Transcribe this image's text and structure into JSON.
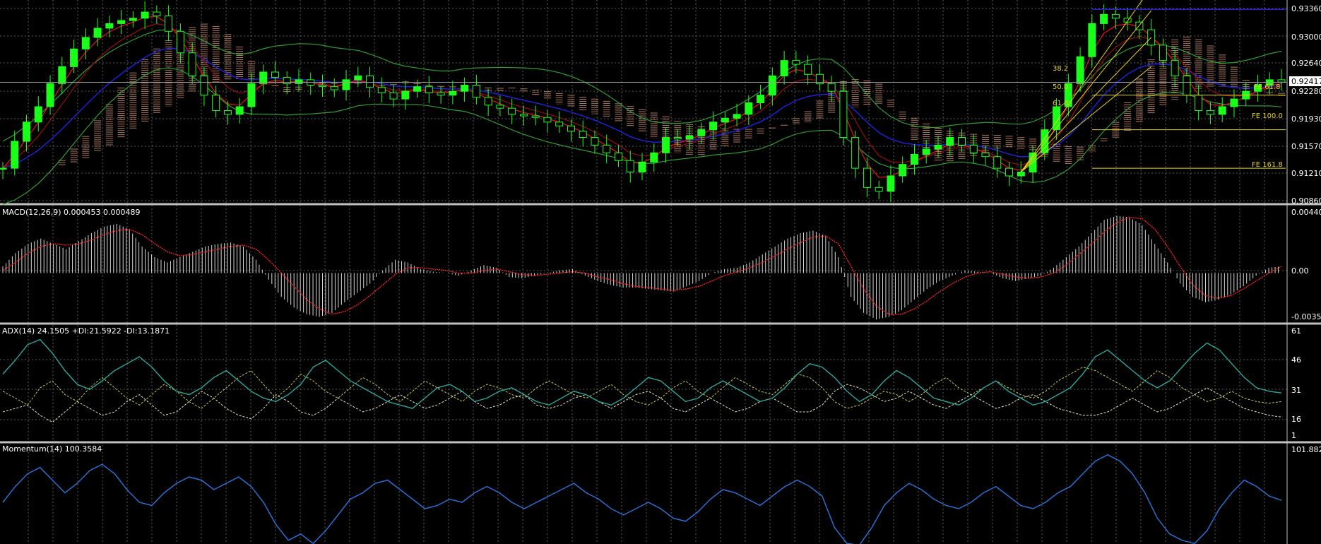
{
  "colors": {
    "background": "#000000",
    "grid": "#5a5a5a",
    "separator": "#bfbfbf",
    "candle": "#1aff1a",
    "bollinger": "#2e9e2e",
    "ma_blue": "#1f1fd6",
    "ma_red": "#e01010",
    "ma_darkred": "#8a0e0e",
    "cloud": "#e6a27a",
    "fib": "#e6d21a",
    "macd_hist": "#d8d8d8",
    "macd_signal": "#ff2020",
    "adx_main": "#2aa79b",
    "plus_di": "#c8c84a",
    "minus_di": "#e6e6c8",
    "momentum": "#2a6fd1",
    "price_box_bg": "#ffffff",
    "text": "#ffffff"
  },
  "price_panel": {
    "axis_labels": [
      "0.93360",
      "0.93000",
      "0.92640",
      "0.92280",
      "0.91930",
      "0.91570",
      "0.91210",
      "0.90860"
    ],
    "current_price": "0.92417",
    "fib_retracement_labels": [
      "38.2",
      "50.0",
      "61.8"
    ],
    "fib_expansion_labels": [
      "FE 61.8",
      "FE 100.0",
      "FE 161.8"
    ]
  },
  "macd_panel": {
    "title": "MACD(12,26,9) 0.000453 0.000489",
    "axis_labels": [
      "0.004405",
      "0.00",
      "-0.003527"
    ]
  },
  "adx_panel": {
    "title": "ADX(14) 24.1505 +DI:21.5922 -DI:13.1871",
    "axis_labels": [
      "61",
      "46",
      "31",
      "16",
      "1"
    ]
  },
  "momentum_panel": {
    "title": "Momentum(14) 100.3584",
    "axis_labels": [
      "101.8825"
    ]
  },
  "chart_data": [
    {
      "type": "line",
      "subtype": "candlestick",
      "ylim": [
        0.9086,
        0.9345
      ],
      "y_ticks": [
        0.9336,
        0.93,
        0.9264,
        0.9228,
        0.9193,
        0.9157,
        0.9121,
        0.9086
      ],
      "grid": true,
      "series": [
        {
          "values": [
            0.913,
            0.9165,
            0.919,
            0.921,
            0.924,
            0.9262,
            0.9285,
            0.93,
            0.9312,
            0.9318,
            0.9322,
            0.9325,
            0.9333,
            0.9328,
            0.9308,
            0.928,
            0.925,
            0.9225,
            0.9205,
            0.92,
            0.921,
            0.924,
            0.9255,
            0.9248,
            0.924,
            0.9245,
            0.9238,
            0.9236,
            0.9232,
            0.9245,
            0.925,
            0.9235,
            0.9228,
            0.922,
            0.923,
            0.9236,
            0.9228,
            0.9225,
            0.923,
            0.9238,
            0.9222,
            0.9212,
            0.9208,
            0.92,
            0.9198,
            0.9196,
            0.919,
            0.9185,
            0.9178,
            0.917,
            0.916,
            0.915,
            0.914,
            0.9125,
            0.9138,
            0.915,
            0.917,
            0.9168,
            0.9172,
            0.918,
            0.919,
            0.9195,
            0.92,
            0.9215,
            0.9225,
            0.925,
            0.927,
            0.9265,
            0.9252,
            0.924,
            0.923,
            0.917,
            0.913,
            0.9105,
            0.91,
            0.912,
            0.9135,
            0.9148,
            0.9155,
            0.916,
            0.917,
            0.916,
            0.915,
            0.9145,
            0.913,
            0.912,
            0.9125,
            0.915,
            0.918,
            0.921,
            0.924,
            0.9275,
            0.9318,
            0.933,
            0.9325,
            0.932,
            0.931,
            0.929,
            0.927,
            0.925,
            0.9225,
            0.9205,
            0.92,
            0.921,
            0.922,
            0.923,
            0.9238,
            0.9245,
            0.9242
          ]
        }
      ]
    },
    {
      "type": "bar",
      "title": "MACD(12,26,9) 0.000453 0.000489",
      "ylim": [
        -0.0037,
        0.0046
      ],
      "y_ticks": [
        0.004405,
        0.0,
        -0.003527
      ],
      "series": [
        {
          "values": [
            0.0005,
            0.0015,
            0.0022,
            0.0026,
            0.0022,
            0.0018,
            0.0024,
            0.003,
            0.0035,
            0.0037,
            0.0033,
            0.002,
            0.0012,
            0.0008,
            0.0012,
            0.0016,
            0.002,
            0.0022,
            0.0023,
            0.002,
            0.001,
            -0.0005,
            -0.0018,
            -0.0026,
            -0.0031,
            -0.0033,
            -0.003,
            -0.0022,
            -0.0015,
            -0.0008,
            0.0002,
            0.001,
            0.0008,
            0.0003,
            0.0001,
            0.0,
            -0.0002,
            0.0002,
            0.0006,
            0.0004,
            -0.0003,
            -0.0004,
            -0.0002,
            0.0,
            0.0002,
            0.0003,
            -0.0002,
            -0.0006,
            -0.0009,
            -0.0011,
            -0.0011,
            -0.0012,
            -0.0013,
            -0.0014,
            -0.001,
            -0.0006,
            0.0,
            0.0003,
            0.0004,
            0.0008,
            0.0014,
            0.002,
            0.0026,
            0.003,
            0.0032,
            0.0028,
            0.0012,
            -0.0018,
            -0.003,
            -0.0035,
            -0.0033,
            -0.0028,
            -0.002,
            -0.0012,
            -0.0006,
            -0.0002,
            0.0002,
            0.0001,
            0.0,
            -0.0004,
            -0.0006,
            -0.0004,
            -0.0002,
            0.0004,
            0.0012,
            0.002,
            0.003,
            0.004,
            0.0043,
            0.0042,
            0.0036,
            0.0022,
            0.0008,
            -0.0008,
            -0.0018,
            -0.0022,
            -0.002,
            -0.0016,
            -0.001,
            -0.0002,
            0.0004,
            0.0005
          ]
        },
        {
          "values": [
            0.0002,
            0.0008,
            0.0015,
            0.002,
            0.0022,
            0.0021,
            0.0022,
            0.0025,
            0.0029,
            0.0032,
            0.0033,
            0.0029,
            0.0022,
            0.0016,
            0.0013,
            0.0014,
            0.0016,
            0.0018,
            0.002,
            0.0021,
            0.0018,
            0.001,
            0.0,
            -0.001,
            -0.002,
            -0.0027,
            -0.0031,
            -0.0029,
            -0.0024,
            -0.0017,
            -0.0009,
            -0.0001,
            0.0004,
            0.0004,
            0.0003,
            0.0002,
            0.0,
            0.0,
            0.0002,
            0.0003,
            0.0001,
            -0.0001,
            -0.0002,
            -0.0001,
            0.0,
            0.0001,
            0.0,
            -0.0003,
            -0.0005,
            -0.0008,
            -0.001,
            -0.0011,
            -0.0012,
            -0.0013,
            -0.0012,
            -0.001,
            -0.0006,
            -0.0002,
            0.0001,
            0.0004,
            0.0008,
            0.0013,
            0.0018,
            0.0023,
            0.0027,
            0.0028,
            0.0022,
            0.0005,
            -0.0012,
            -0.0025,
            -0.0031,
            -0.0031,
            -0.0027,
            -0.0021,
            -0.0014,
            -0.0008,
            -0.0003,
            0.0,
            0.0001,
            -0.0001,
            -0.0003,
            -0.0004,
            -0.0003,
            0.0,
            0.0006,
            0.0014,
            0.0022,
            0.0031,
            0.0038,
            0.0042,
            0.0041,
            0.0033,
            0.002,
            0.0005,
            -0.0009,
            -0.0017,
            -0.0019,
            -0.0017,
            -0.0012,
            -0.0006,
            0.0,
            0.0005
          ]
        }
      ]
    },
    {
      "type": "line",
      "title": "ADX(14) 24.1505 +DI:21.5922 -DI:13.1871",
      "ylim": [
        0,
        64
      ],
      "y_ticks": [
        61,
        46,
        31,
        16,
        1
      ],
      "series": [
        {
          "values": [
            38,
            46,
            55,
            58,
            50,
            40,
            32,
            29,
            34,
            40,
            44,
            48,
            42,
            34,
            28,
            26,
            30,
            36,
            40,
            34,
            28,
            24,
            22,
            26,
            32,
            42,
            46,
            40,
            34,
            30,
            26,
            22,
            20,
            18,
            24,
            30,
            32,
            28,
            22,
            24,
            28,
            30,
            26,
            22,
            20,
            24,
            28,
            26,
            22,
            20,
            24,
            30,
            36,
            34,
            28,
            22,
            24,
            30,
            34,
            30,
            26,
            22,
            24,
            30,
            38,
            44,
            42,
            36,
            28,
            22,
            26,
            34,
            40,
            36,
            30,
            24,
            22,
            20,
            24,
            30,
            34,
            28,
            24,
            20,
            22,
            26,
            30,
            38,
            48,
            52,
            46,
            40,
            34,
            30,
            34,
            42,
            50,
            56,
            52,
            44,
            36,
            30,
            28,
            27
          ]
        },
        {
          "values": [
            28,
            24,
            20,
            30,
            34,
            26,
            22,
            30,
            36,
            30,
            24,
            20,
            26,
            32,
            28,
            22,
            18,
            24,
            30,
            36,
            40,
            32,
            24,
            30,
            38,
            34,
            28,
            24,
            30,
            36,
            32,
            26,
            22,
            28,
            34,
            30,
            26,
            22,
            28,
            32,
            30,
            26,
            24,
            30,
            34,
            30,
            26,
            24,
            28,
            32,
            26,
            22,
            20,
            24,
            30,
            34,
            28,
            24,
            30,
            36,
            32,
            28,
            26,
            32,
            38,
            36,
            30,
            22,
            18,
            20,
            24,
            28,
            26,
            22,
            26,
            32,
            36,
            30,
            26,
            30,
            34,
            30,
            26,
            24,
            28,
            34,
            38,
            42,
            40,
            36,
            32,
            28,
            34,
            40,
            36,
            30,
            26,
            22,
            24,
            28,
            24,
            22,
            21,
            22
          ]
        },
        {
          "values": [
            16,
            18,
            20,
            14,
            10,
            16,
            22,
            18,
            14,
            16,
            22,
            26,
            20,
            14,
            16,
            22,
            28,
            24,
            18,
            14,
            12,
            18,
            26,
            22,
            16,
            14,
            18,
            24,
            20,
            16,
            18,
            22,
            26,
            22,
            18,
            20,
            24,
            28,
            22,
            18,
            20,
            24,
            26,
            20,
            18,
            20,
            24,
            26,
            22,
            18,
            22,
            26,
            28,
            24,
            18,
            16,
            20,
            24,
            20,
            16,
            18,
            22,
            24,
            20,
            16,
            16,
            20,
            28,
            32,
            30,
            26,
            22,
            24,
            28,
            24,
            20,
            18,
            22,
            26,
            22,
            18,
            20,
            24,
            26,
            22,
            18,
            16,
            14,
            14,
            16,
            20,
            24,
            20,
            16,
            18,
            22,
            26,
            30,
            26,
            22,
            18,
            16,
            14,
            13
          ]
        }
      ]
    },
    {
      "type": "line",
      "title": "Momentum(14) 100.3584",
      "ylim": [
        98.85,
        101.95
      ],
      "y_ticks": [
        101.8825
      ],
      "series": [
        {
          "values": [
            100.3,
            100.8,
            101.2,
            101.4,
            101.0,
            100.6,
            100.9,
            101.3,
            101.5,
            101.2,
            100.7,
            100.3,
            100.2,
            100.6,
            100.9,
            101.1,
            101.0,
            100.7,
            100.9,
            101.1,
            100.8,
            100.3,
            99.6,
            99.1,
            99.3,
            99.0,
            99.4,
            99.9,
            100.4,
            100.6,
            100.9,
            101.0,
            100.7,
            100.4,
            100.1,
            100.2,
            100.4,
            100.3,
            100.6,
            100.8,
            100.6,
            100.3,
            100.1,
            100.3,
            100.5,
            100.7,
            100.9,
            100.6,
            100.4,
            100.1,
            99.9,
            100.1,
            100.3,
            100.1,
            99.8,
            99.7,
            100.0,
            100.4,
            100.7,
            100.6,
            100.4,
            100.2,
            100.5,
            100.8,
            101.0,
            100.8,
            100.5,
            99.5,
            99.0,
            98.95,
            99.5,
            100.2,
            100.6,
            100.9,
            100.7,
            100.4,
            100.2,
            100.1,
            100.3,
            100.6,
            100.8,
            100.5,
            100.2,
            100.1,
            100.3,
            100.6,
            100.8,
            101.2,
            101.6,
            101.8,
            101.6,
            101.2,
            100.6,
            99.8,
            99.3,
            99.1,
            99.0,
            99.4,
            100.1,
            100.6,
            101.0,
            100.8,
            100.5,
            100.36
          ]
        }
      ]
    }
  ]
}
